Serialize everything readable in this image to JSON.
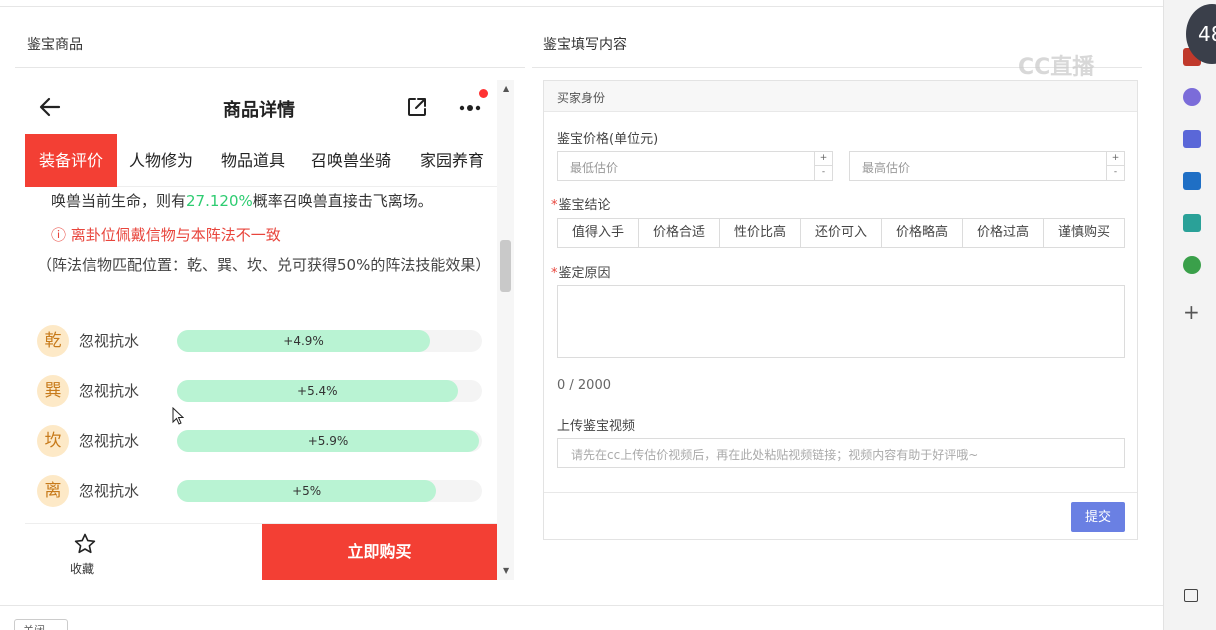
{
  "left_panel": {
    "title": "鉴宝商品"
  },
  "right_panel": {
    "title": "鉴宝填写内容"
  },
  "phone": {
    "header_title": "商品详情",
    "tabs": [
      "装备评价",
      "人物修为",
      "物品道具",
      "召唤兽坐骑",
      "家园养育"
    ],
    "active_tab": 0,
    "line1_pre": "唤兽当前生命，则有",
    "line1_pct": "27.120%",
    "line1_post": "概率召唤兽直接击飞离场。",
    "warning": "ⓘ 离卦位佩戴信物与本阵法不一致",
    "description": "（阵法信物匹配位置：乾、巽、坎、兑可获得50%的阵法技能效果）",
    "rows": [
      {
        "badge": "乾",
        "label": "忽视抗水",
        "value": "+4.9%",
        "fill_pct": 83
      },
      {
        "badge": "巽",
        "label": "忽视抗水",
        "value": "+5.4%",
        "fill_pct": 92
      },
      {
        "badge": "坎",
        "label": "忽视抗水",
        "value": "+5.9%",
        "fill_pct": 99
      },
      {
        "badge": "离",
        "label": "忽视抗水",
        "value": "+5%",
        "fill_pct": 85
      }
    ],
    "favorite_label": "收藏",
    "buy_label": "立即购买"
  },
  "form": {
    "card_title": "买家身份",
    "price_label": "鉴宝价格(单位元)",
    "min_placeholder": "最低估价",
    "max_placeholder": "最高估价",
    "conclusion_label": "鉴宝结论",
    "conclusions": [
      "值得入手",
      "价格合适",
      "性价比高",
      "还价可入",
      "价格略高",
      "价格过高",
      "谨慎购买"
    ],
    "reason_label": "鉴定原因",
    "counter": "0 / 2000",
    "video_label": "上传鉴宝视频",
    "video_placeholder": "请先在cc上传估价视频后，再在此处粘贴视频链接；视频内容有助于好评哦~",
    "submit_label": "提交"
  },
  "bottom_button": "关闭",
  "overlay_number": "48",
  "watermark": "CC直播",
  "colors": {
    "accent_red": "#f33f34",
    "submit_blue": "#6a80e3",
    "bar_green": "#b9f3d3",
    "pct_green": "#2ecc71"
  }
}
